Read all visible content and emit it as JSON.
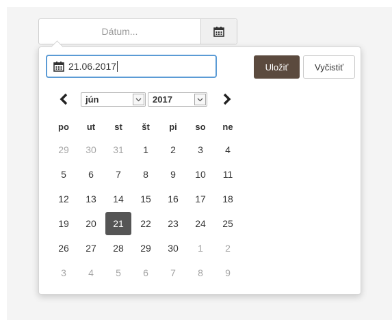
{
  "input": {
    "placeholder": "Dátum...",
    "icon": "calendar-icon"
  },
  "popup": {
    "value": "21.06.2017",
    "value_icon": "calendar-icon",
    "save_label": "Uložiť",
    "clear_label": "Vyčistiť",
    "month": "jún",
    "year": "2017",
    "weekdays": [
      "po",
      "ut",
      "st",
      "št",
      "pi",
      "so",
      "ne"
    ],
    "weeks": [
      [
        {
          "d": "29",
          "o": true
        },
        {
          "d": "30",
          "o": true
        },
        {
          "d": "31",
          "o": true
        },
        {
          "d": "1"
        },
        {
          "d": "2"
        },
        {
          "d": "3"
        },
        {
          "d": "4"
        }
      ],
      [
        {
          "d": "5"
        },
        {
          "d": "6"
        },
        {
          "d": "7"
        },
        {
          "d": "8"
        },
        {
          "d": "9"
        },
        {
          "d": "10"
        },
        {
          "d": "11"
        }
      ],
      [
        {
          "d": "12"
        },
        {
          "d": "13"
        },
        {
          "d": "14"
        },
        {
          "d": "15"
        },
        {
          "d": "16"
        },
        {
          "d": "17"
        },
        {
          "d": "18"
        }
      ],
      [
        {
          "d": "19"
        },
        {
          "d": "20"
        },
        {
          "d": "21",
          "s": true
        },
        {
          "d": "22"
        },
        {
          "d": "23"
        },
        {
          "d": "24"
        },
        {
          "d": "25"
        }
      ],
      [
        {
          "d": "26"
        },
        {
          "d": "27"
        },
        {
          "d": "28"
        },
        {
          "d": "29"
        },
        {
          "d": "30"
        },
        {
          "d": "1",
          "o": true
        },
        {
          "d": "2",
          "o": true
        }
      ],
      [
        {
          "d": "3",
          "o": true
        },
        {
          "d": "4",
          "o": true
        },
        {
          "d": "5",
          "o": true
        },
        {
          "d": "6",
          "o": true
        },
        {
          "d": "7",
          "o": true
        },
        {
          "d": "8",
          "o": true
        },
        {
          "d": "9",
          "o": true
        }
      ]
    ]
  },
  "colors": {
    "accent": "#5b9bd5",
    "save_button": "#5b4a3e",
    "selected_day": "#555555"
  }
}
